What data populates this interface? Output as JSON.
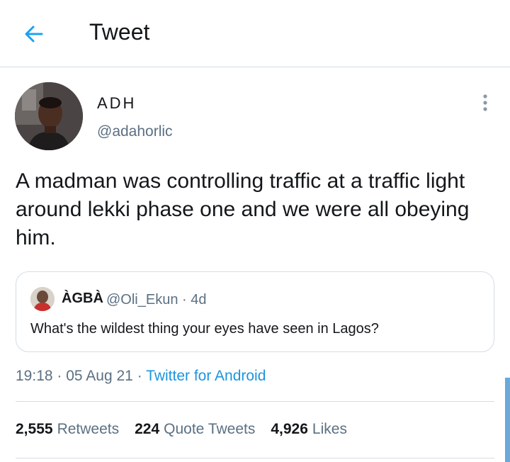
{
  "header": {
    "title": "Tweet",
    "back_icon": "arrow-left-icon",
    "accent": "#1da1f2"
  },
  "author": {
    "display_name": "ADH",
    "handle": "@adahorlic"
  },
  "tweet": {
    "text": "A madman was controlling traffic at a traffic light around lekki phase one and we were all obeying him."
  },
  "quote": {
    "name": "ÀGBÀ",
    "handle": "@Oli_Ekun",
    "age": "4d",
    "text": "What's the wildest thing your eyes have seen in Lagos?"
  },
  "meta": {
    "time": "19:18",
    "date": "05 Aug 21",
    "client": "Twitter for Android",
    "sep": "·"
  },
  "stats": {
    "retweets_count": "2,555",
    "retweets_label": "Retweets",
    "quotes_count": "224",
    "quotes_label": "Quote Tweets",
    "likes_count": "4,926",
    "likes_label": "Likes"
  },
  "colors": {
    "link": "#1b95e0",
    "secondary_text": "#5b7083",
    "border": "#d5dde3"
  }
}
